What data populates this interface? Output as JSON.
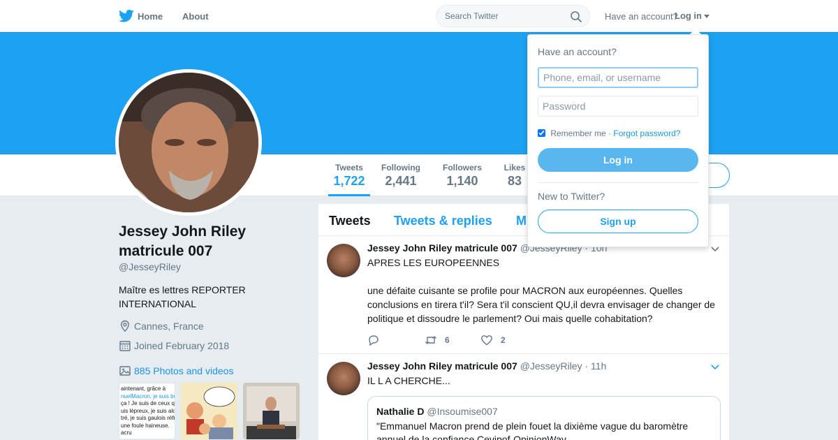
{
  "nav": {
    "home": "Home",
    "about": "About",
    "search_placeholder": "Search Twitter",
    "have_account": "Have an account?",
    "login": "Log in"
  },
  "profile": {
    "name": "Jessey John Riley matricule 007",
    "handle": "@JesseyRiley",
    "bio": "Maître es lettres REPORTER INTERNATIONAL",
    "location": "Cannes, France",
    "joined": "Joined February 2018",
    "photos": "885 Photos and videos"
  },
  "stats": [
    {
      "label": "Tweets",
      "value": "1,722"
    },
    {
      "label": "Following",
      "value": "2,441"
    },
    {
      "label": "Followers",
      "value": "1,140"
    },
    {
      "label": "Likes",
      "value": "83"
    }
  ],
  "timeline_tabs": [
    "Tweets",
    "Tweets & replies",
    "M"
  ],
  "thumbnails": [
    {
      "lines": [
        "aintenant, grâce à",
        "nuelMacron, je suis bea",
        "ça ! Je suis de ceux qui",
        "uis lépreux, je suis alcoo",
        "tré, je suis gaulois réfra",
        "une foule haineuse.",
        "",
        "acru"
      ]
    },
    {
      "lines": []
    },
    {
      "lines": []
    }
  ],
  "tweets": [
    {
      "name": "Jessey John Riley matricule 007",
      "handle": "@JesseyRiley",
      "time": "· 10h",
      "line1": "APRES LES EUROPEENNES",
      "line2": "une défaite cuisante se profile pour MACRON aux européennes. Quelles conclusions en tirera t'il? Sera t'il conscient QU,il devra envisager de changer de politique et dissoudre le parlement? Oui mais quelle cohabitation?",
      "retweets": "6",
      "likes": "2"
    },
    {
      "name": "Jessey John Riley matricule 007",
      "handle": "@JesseyRiley",
      "time": "· 11h",
      "line1": "IL L A CHERCHE...",
      "quote_name": "Nathalie D",
      "quote_handle": "@Insoumise007",
      "quote_text": "\"Emmanuel Macron prend de plein fouet la dixième vague du baromètre annuel de la confiance Cevipof-OpinionWay"
    }
  ],
  "login_dropdown": {
    "title": "Have an account?",
    "username_placeholder": "Phone, email, or username",
    "password_placeholder": "Password",
    "remember": "Remember me",
    "separator": " · ",
    "forgot": "Forgot password?",
    "login_button": "Log in",
    "new_to": "New to Twitter?",
    "signup_button": "Sign up"
  },
  "colors": {
    "brand": "#1da1f2",
    "link": "#1b95e0",
    "muted": "#657786"
  }
}
